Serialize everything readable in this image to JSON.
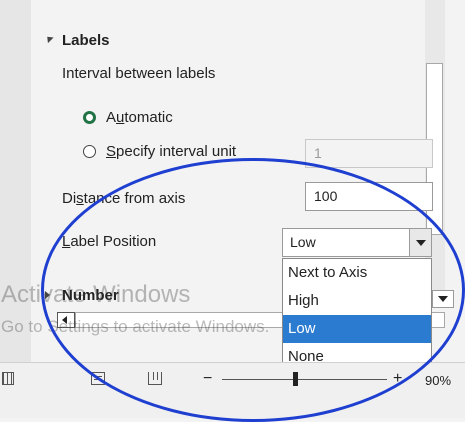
{
  "section": {
    "title": "Labels"
  },
  "interval": {
    "label": "Interval between labels",
    "automatic_pre": "A",
    "automatic_u": "u",
    "automatic_post": "tomatic",
    "specify_u": "S",
    "specify_post": "pecify interval unit",
    "unit_value": "1"
  },
  "distance": {
    "pre": "Di",
    "u": "s",
    "post": "tance from axis",
    "value": "100"
  },
  "label_position": {
    "u": "L",
    "post": "abel Position",
    "selected": "Low",
    "options": [
      "Next to Axis",
      "High",
      "Low",
      "None"
    ],
    "highlighted_index": 2
  },
  "number_section": {
    "title": "Number"
  },
  "watermark": {
    "line1": "Activate Windows",
    "line2": "Go to Settings to activate Windows."
  },
  "status": {
    "zoom": "90%",
    "minus": "−",
    "plus": "+"
  },
  "colors": {
    "accent_green": "#217346",
    "highlight_blue": "#2b7bd0",
    "annotation_ellipse": "#1e3fd0"
  }
}
